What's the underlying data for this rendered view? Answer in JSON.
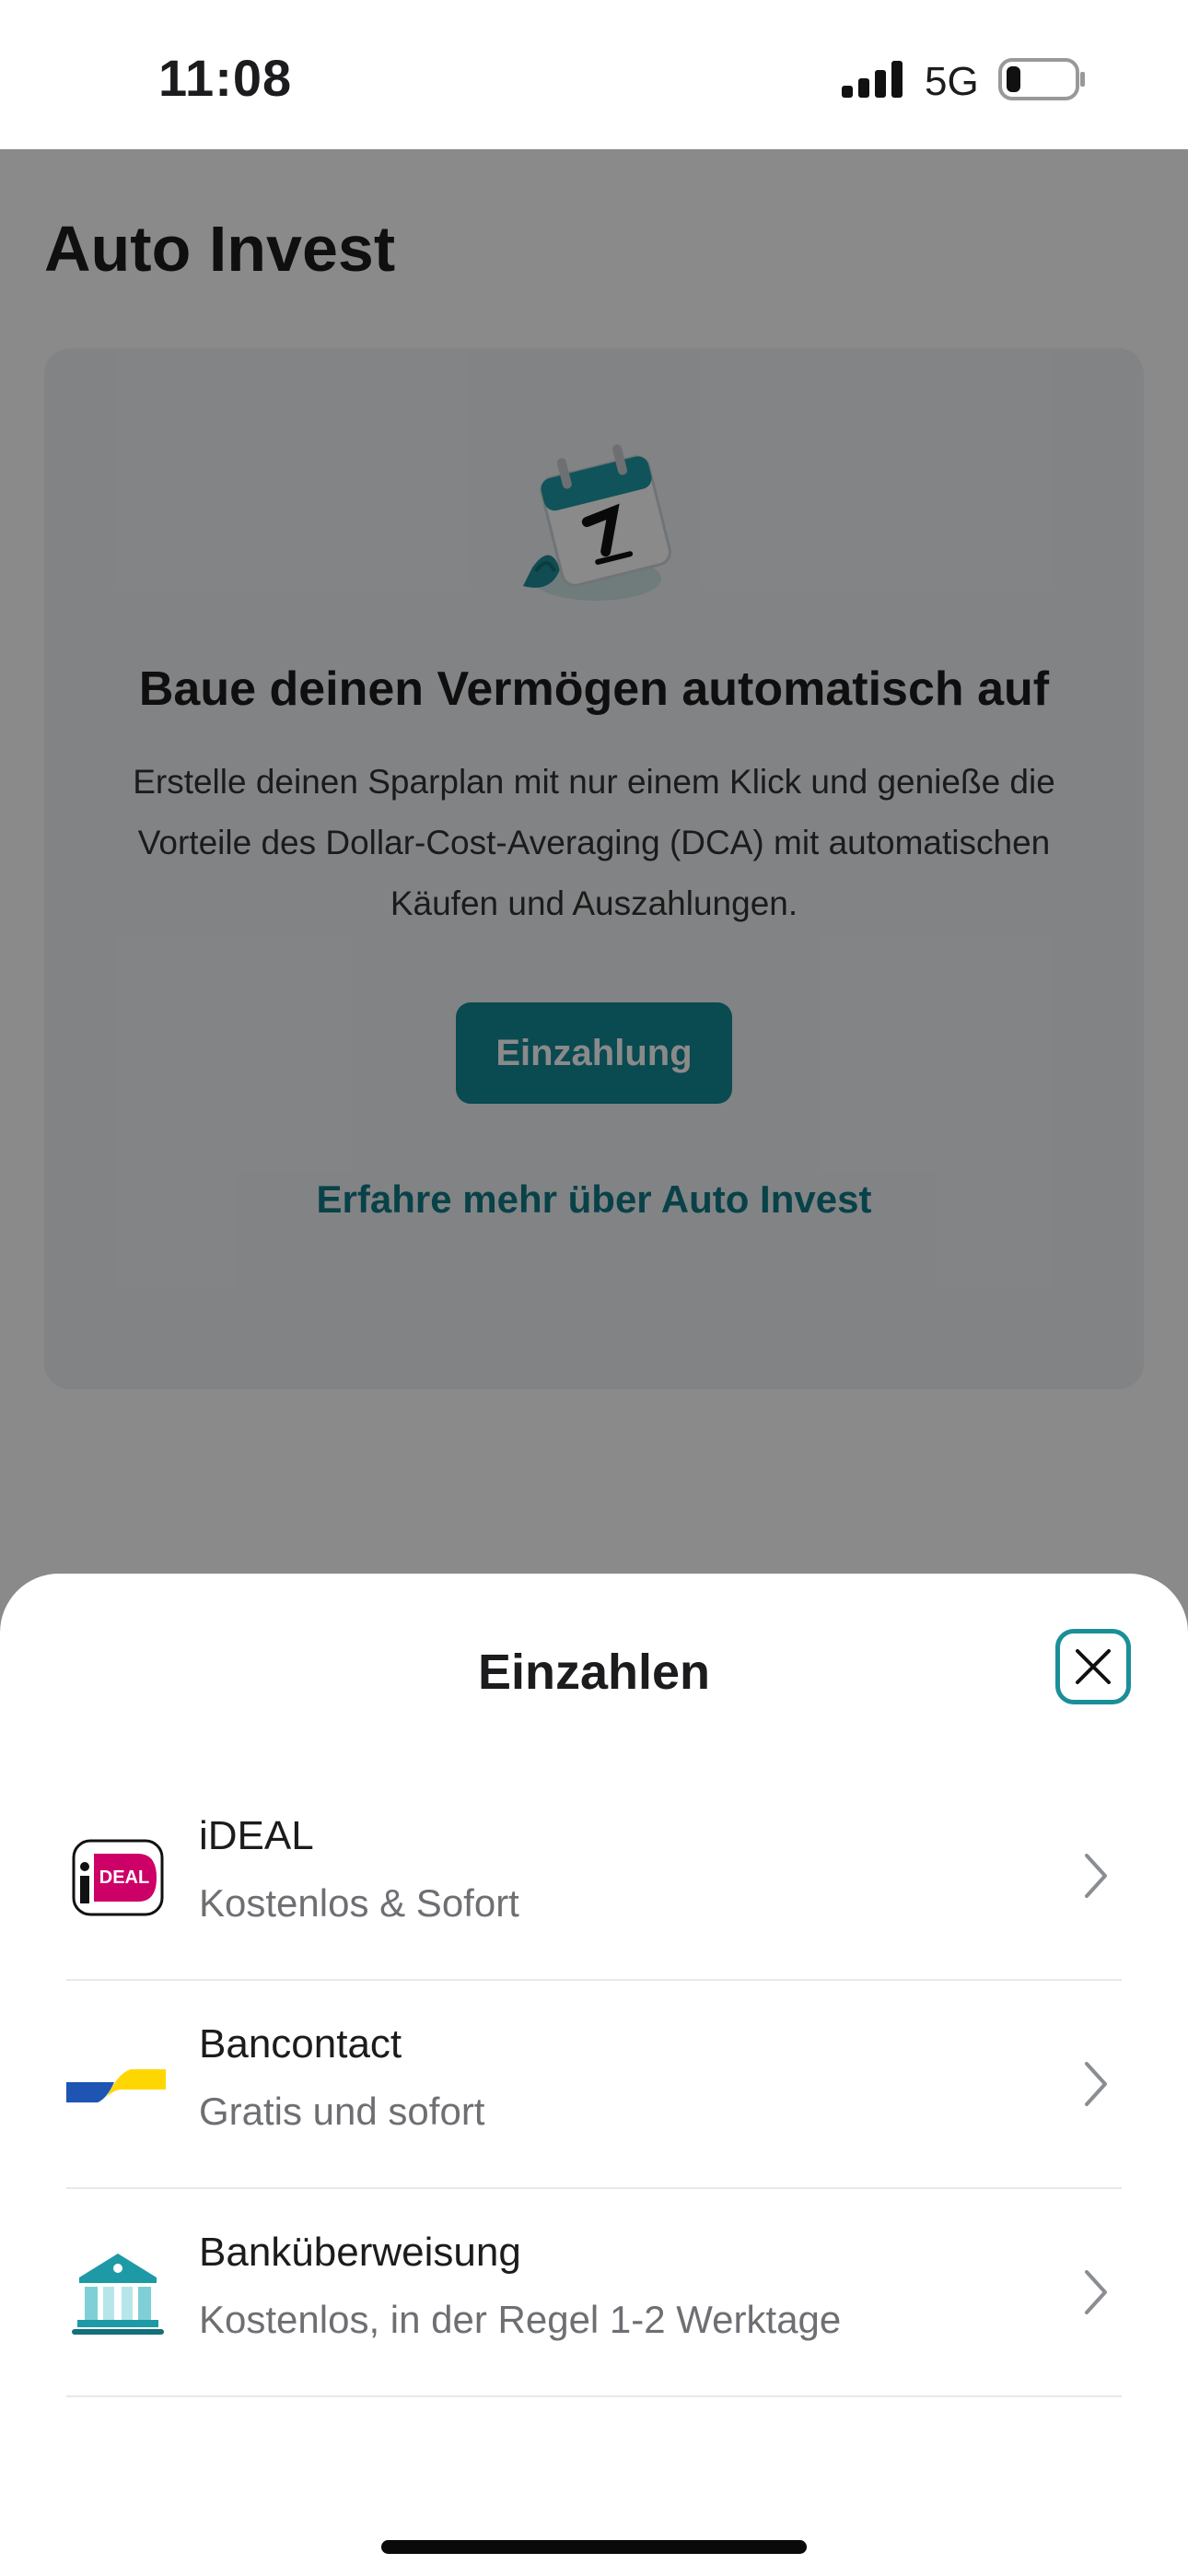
{
  "status_bar": {
    "time": "11:08",
    "network": "5G"
  },
  "page": {
    "title": "Auto Invest",
    "card": {
      "heading": "Baue deinen Vermögen automatisch auf",
      "body": "Erstelle deinen Sparplan mit nur einem Klick und genieße die Vorteile des Dollar-Cost-Averaging (DCA) mit automatischen Käufen und Auszahlungen.",
      "cta_label": "Einzahlung",
      "link_label": "Erfahre mehr über Auto Invest"
    }
  },
  "sheet": {
    "title": "Einzahlen",
    "methods": [
      {
        "icon": "ideal-logo-icon",
        "name": "iDEAL",
        "description": "Kostenlos & Sofort",
        "logo_text": "DEAL"
      },
      {
        "icon": "bancontact-logo-icon",
        "name": "Bancontact",
        "description": "Gratis und sofort"
      },
      {
        "icon": "bank-icon",
        "name": "Banküberweisung",
        "description": "Kostenlos, in der Regel 1-2 Werktage"
      }
    ]
  },
  "colors": {
    "accent": "#138a96",
    "link": "#0f7a86",
    "ideal_pink": "#cc0066",
    "bancontact_blue": "#1e55b3",
    "bancontact_yellow": "#ffd700"
  }
}
